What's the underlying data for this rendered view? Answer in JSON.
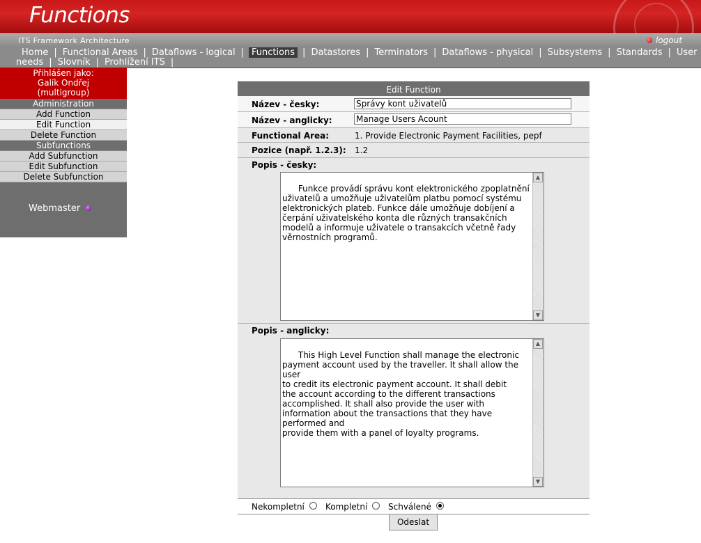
{
  "header": {
    "title": "Functions",
    "subtitle": "ITS Framework Architecture",
    "logout": "logout"
  },
  "nav": {
    "line1": [
      "Home",
      "Functional Areas",
      "Dataflows - logical",
      "Functions",
      "Datastores",
      "Terminators",
      "Dataflows - physical",
      "Subsystems",
      "Standards",
      "User"
    ],
    "line2": [
      "needs",
      "Slovník",
      "Prohlížení ITS"
    ],
    "active": "Functions"
  },
  "sidebar": {
    "login_line1": "Přihlášen jako:",
    "login_line2": "Galík Ondřej",
    "login_line3": "(multigroup)",
    "admin_head": "Administration",
    "admin_items": [
      "Add Function",
      "Edit Function",
      "Delete Function"
    ],
    "sub_head": "Subfunctions",
    "sub_items": [
      "Add Subfunction",
      "Edit Subfunction",
      "Delete Subfunction"
    ],
    "current": "Edit Function",
    "webmaster": "Webmaster"
  },
  "form": {
    "heading": "Edit Function",
    "name_cz_label": "Název - česky:",
    "name_cz_value": "Správy kont uživatelů",
    "name_en_label": "Název - anglicky:",
    "name_en_value": "Manage Users Acount",
    "area_label": "Functional Area:",
    "area_value": "1. Provide Electronic Payment Facilities, pepf",
    "pos_label": "Pozice (např. 1.2.3):",
    "pos_value": "1.2",
    "desc_cz_label": "Popis - česky:",
    "desc_cz_value": "Funkce provádí správu kont elektronického zpoplatnění\nuživatelů a umožňuje uživatelům platbu pomocí systému\nelektronických plateb. Funkce dále umožňuje dobíjení a\nčerpání uživatelského konta dle různých transakčních\nmodelů a informuje uživatele o transakcích včetně řady\nvěrnostních programů.",
    "desc_en_label": "Popis - anglicky:",
    "desc_en_value": "This High Level Function shall manage the electronic\npayment account used by the traveller. It shall allow the\nuser\nto credit its electronic payment account. It shall debit\nthe account according to the different transactions\naccomplished. It shall also provide the user with\ninformation about the transactions that they have\nperformed and\nprovide them with a panel of loyalty programs.",
    "status_options": [
      "Nekompletní",
      "Kompletní",
      "Schválené"
    ],
    "status_selected": "Schválené",
    "submit": "Odeslat"
  }
}
